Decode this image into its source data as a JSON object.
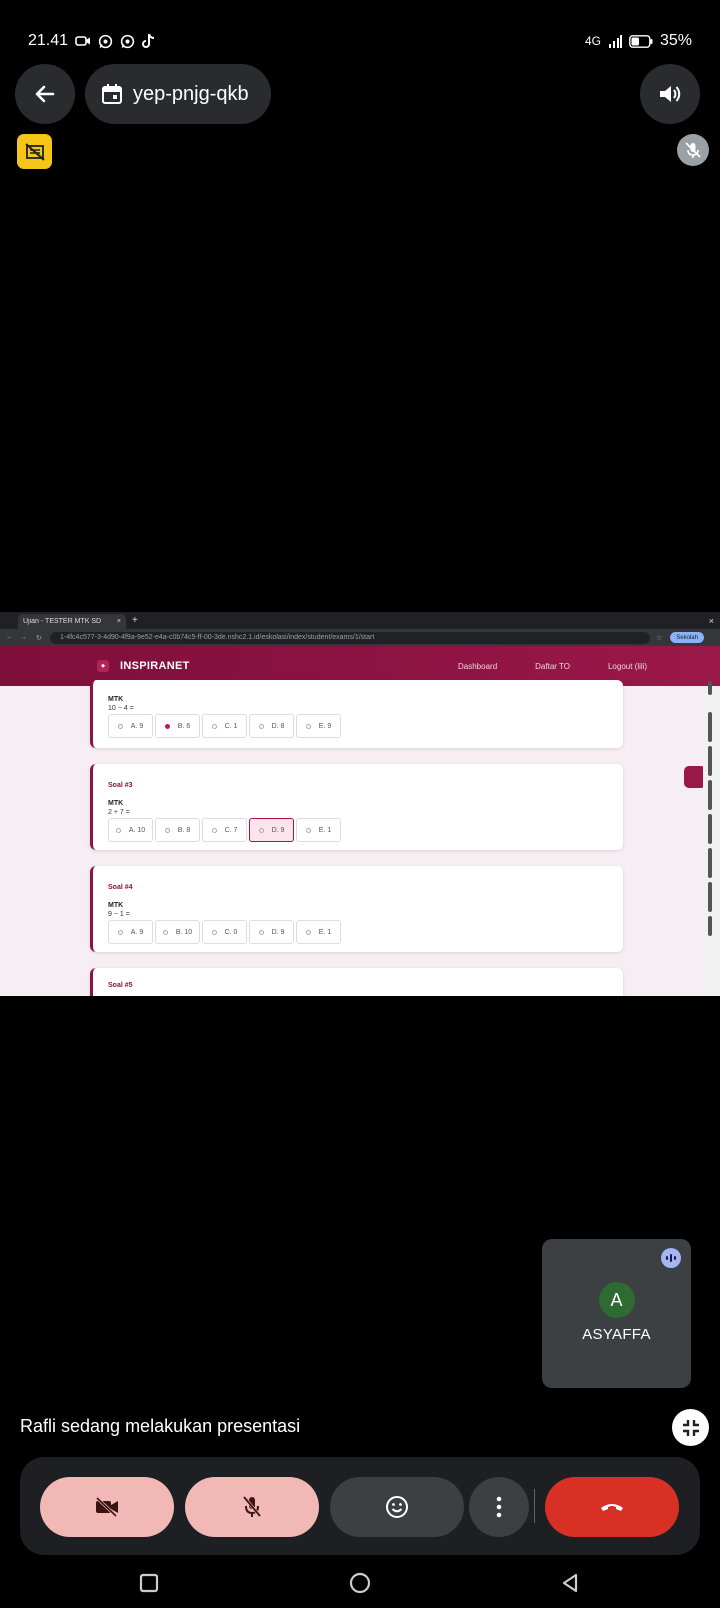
{
  "status": {
    "time": "21.41",
    "network": "4G",
    "battery": "35%"
  },
  "meeting": {
    "code": "yep-pnjg-qkb",
    "presenting_text": "Rafli sedang melakukan presentasi"
  },
  "participant": {
    "initial": "A",
    "name": "ASYAFFA"
  },
  "browser": {
    "tab_title": "Ujian - TESTER MTK SD",
    "url": "1-4fc4c577-3-4d90-4f9a-9e52-e4a-c0b74c5-ff-00-3de.nshc2.1.id/eskolasi/index/student/exams/1/start",
    "profile": "Sekolah"
  },
  "app": {
    "brand": "INSPIRANET",
    "nav": [
      "Dashboard",
      "Daftar TO",
      "Logout (lili)"
    ],
    "questions": [
      {
        "label": "",
        "subject": "MTK",
        "question": "10 − 4 =",
        "options": [
          "A. 9",
          "B. 6",
          "C. 1",
          "D. 8",
          "E. 9"
        ],
        "selected": 1
      },
      {
        "label": "Soal #3",
        "subject": "MTK",
        "question": "2 + 7 =",
        "options": [
          "A. 10",
          "B. 8",
          "C. 7",
          "D. 9",
          "E. 1"
        ],
        "hover": 3
      },
      {
        "label": "Soal #4",
        "subject": "MTK",
        "question": "9 − 1 =",
        "options": [
          "A. 9",
          "B. 10",
          "C. 0",
          "D. 9",
          "E. 1"
        ]
      },
      {
        "label": "Soal #5"
      }
    ]
  },
  "colors": {
    "accent": "#8a1540",
    "end_call": "#d93025",
    "muted_button": "#f2b8b5"
  }
}
